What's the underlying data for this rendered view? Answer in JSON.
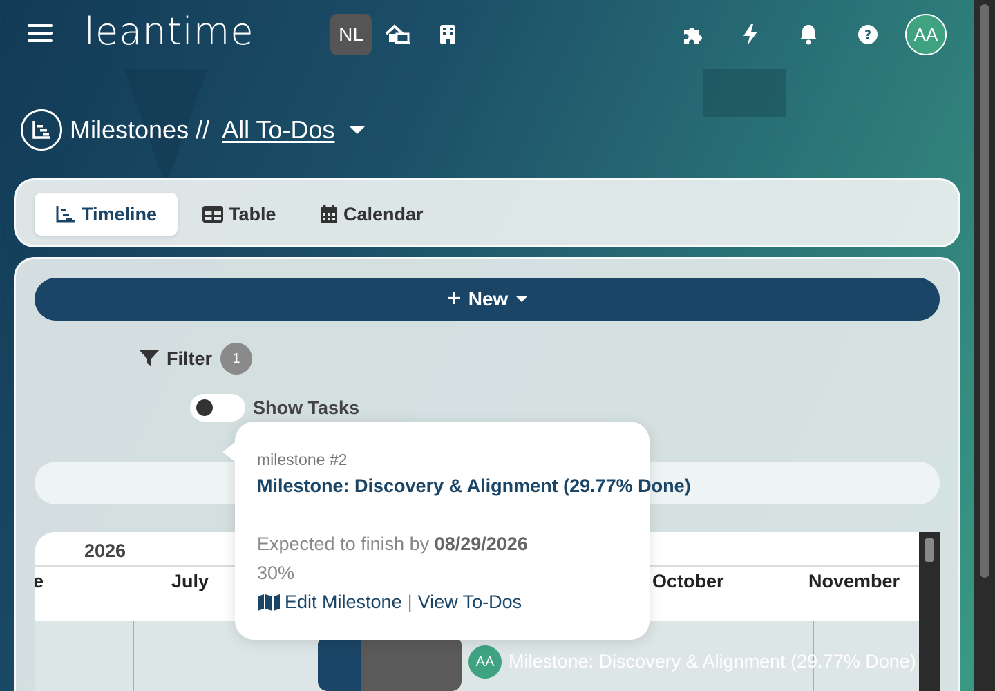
{
  "header": {
    "logo": "leantime",
    "workspace_initials": "NL",
    "user_initials": "AA",
    "icons": [
      "menu-icon",
      "home-monitor-icon",
      "building-icon",
      "puzzle-icon",
      "bolt-icon",
      "bell-icon",
      "help-icon"
    ]
  },
  "page": {
    "title_prefix": "Milestones //",
    "title_link": "All To-Dos "
  },
  "tabs": [
    {
      "label": "Timeline",
      "icon": "timeline-icon",
      "active": true
    },
    {
      "label": "Table",
      "icon": "table-icon",
      "active": false
    },
    {
      "label": "Calendar",
      "icon": "calendar-icon",
      "active": false
    }
  ],
  "toolbar": {
    "new_label": "New",
    "filter_label": "Filter",
    "filter_count": "1",
    "show_tasks_label": "Show Tasks",
    "show_tasks_on": false
  },
  "gantt": {
    "year": "2026",
    "months": [
      "e",
      "July",
      "October",
      "November"
    ],
    "bar_progress": 0.2977,
    "bar_avatar": "AA",
    "bar_label": "Milestone: Discovery & Alignment (29.77% Done)"
  },
  "popover": {
    "id": "milestone #2",
    "title": "Milestone: Discovery & Alignment (29.77% Done)",
    "finish_prefix": "Expected to finish by",
    "finish_date": "08/29/2026",
    "percent": "30%",
    "edit_label": "Edit Milestone",
    "separator": "|",
    "view_label": "View To-Dos"
  },
  "colors": {
    "accent": "#1b4566",
    "avatar": "#3fa382"
  }
}
